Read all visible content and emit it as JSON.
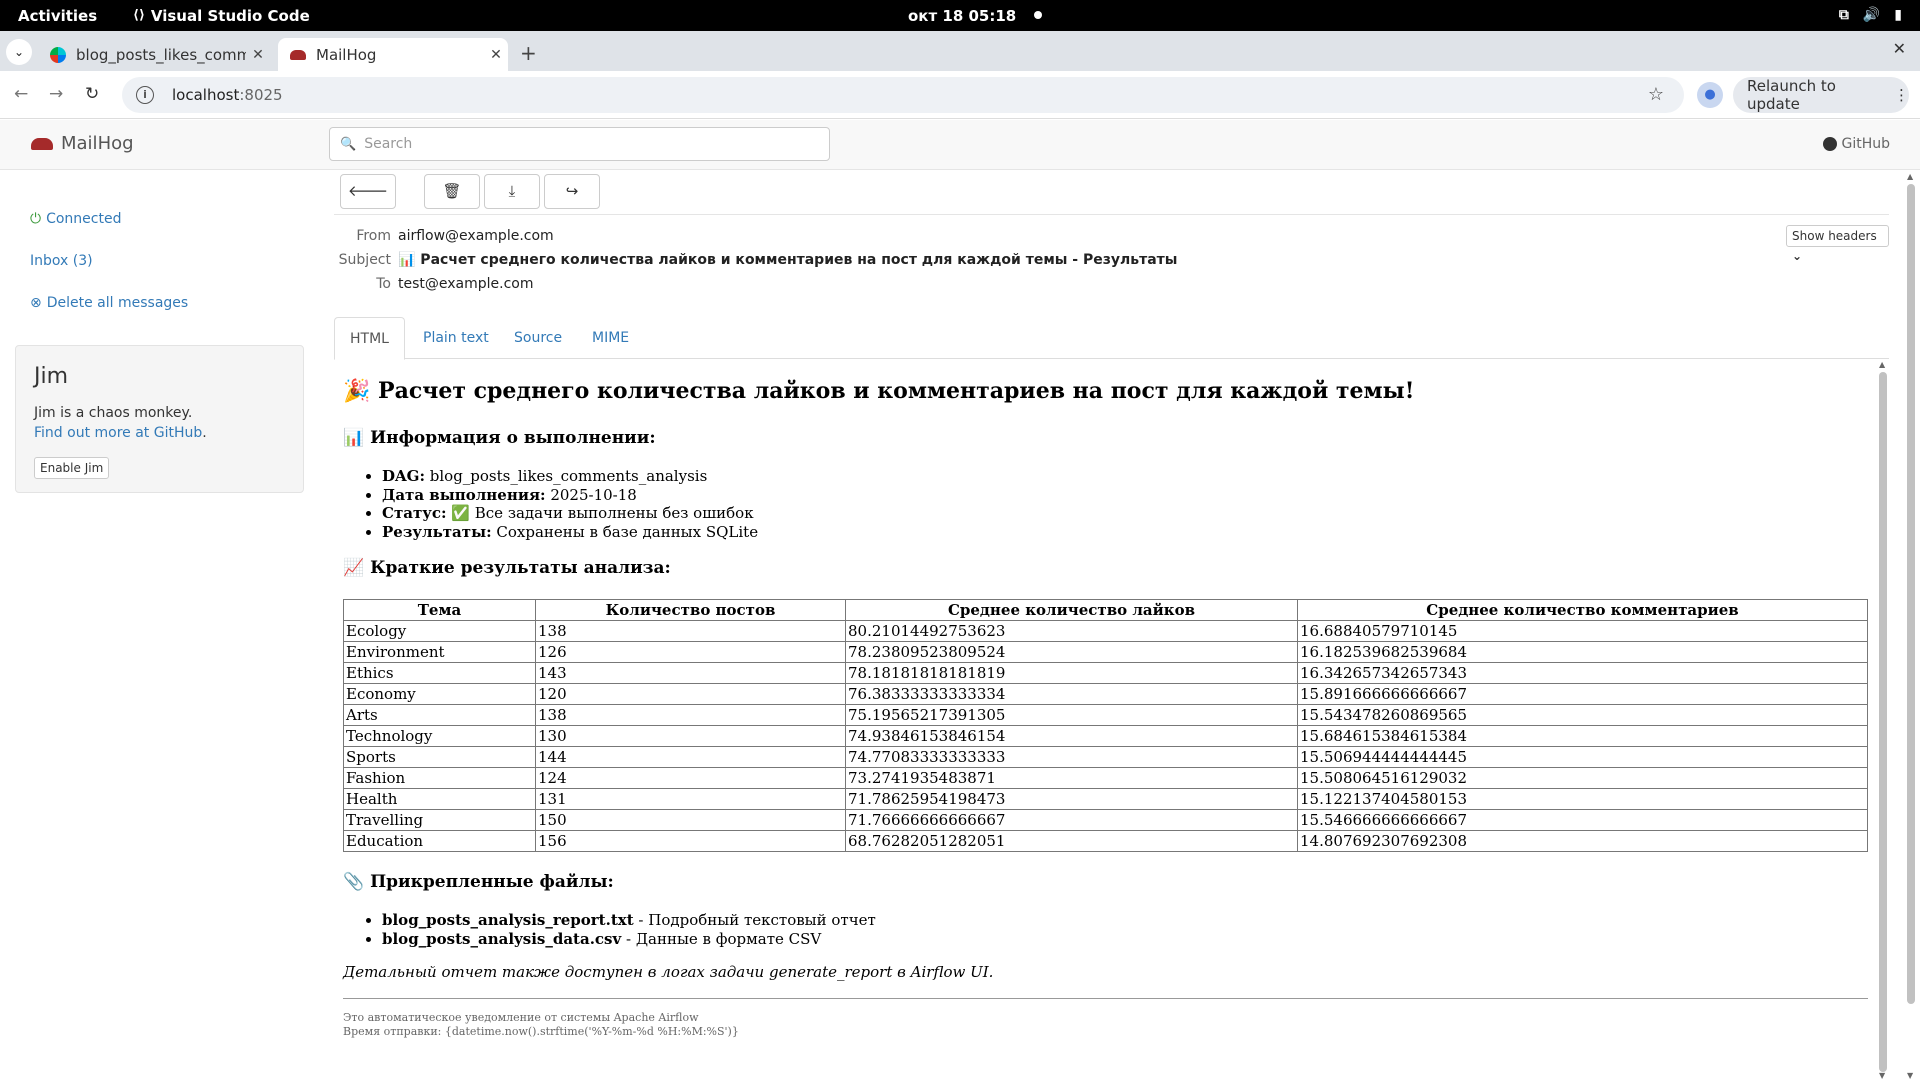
{
  "system": {
    "activities": "Activities",
    "app_name": "Visual Studio Code",
    "clock": "окт 18  05:18"
  },
  "browser": {
    "tabs": [
      {
        "title": "blog_posts_likes_comm"
      },
      {
        "title": "MailHog"
      }
    ],
    "url_host": "localhost",
    "url_port": ":8025",
    "relaunch_label": "Relaunch to update"
  },
  "mailhog": {
    "brand": "MailHog",
    "search_placeholder": "Search",
    "github": "GitHub",
    "sidebar": {
      "connected": "Connected",
      "inbox": "Inbox (3)",
      "delete_all": "Delete all messages"
    },
    "jim": {
      "title": "Jim",
      "desc": "Jim is a chaos monkey.",
      "link": "Find out more at GitHub",
      "link_suffix": ".",
      "button": "Enable Jim"
    },
    "message": {
      "from_label": "From",
      "from": "airflow@example.com",
      "subject_label": "Subject",
      "subject": "📊 Расчет среднего количества лайков и комментариев на пост для каждой темы - Результаты",
      "to_label": "To",
      "to": "test@example.com",
      "show_headers": "Show headers"
    },
    "tabs": [
      "HTML",
      "Plain text",
      "Source",
      "MIME"
    ]
  },
  "email": {
    "title": "🎉 Расчет среднего количества лайков и комментариев на пост для каждой темы!",
    "info_heading": "📊 Информация о выполнении:",
    "info": [
      {
        "key": "DAG:",
        "value": " blog_posts_likes_comments_analysis"
      },
      {
        "key": "Дата выполнения:",
        "value": " 2025-10-18"
      },
      {
        "key": "Статус:",
        "value": " ✅ Все задачи выполнены без ошибок"
      },
      {
        "key": "Результаты:",
        "value": " Сохранены в базе данных SQLite"
      }
    ],
    "results_heading": "📈 Краткие результаты анализа:",
    "table": {
      "headers": [
        "Тема",
        "Количество постов",
        "Среднее количество лайков",
        "Среднее количество комментариев"
      ],
      "rows": [
        [
          "Ecology",
          "138",
          "80.21014492753623",
          "16.68840579710145"
        ],
        [
          "Environment",
          "126",
          "78.23809523809524",
          "16.182539682539684"
        ],
        [
          "Ethics",
          "143",
          "78.18181818181819",
          "16.342657342657343"
        ],
        [
          "Economy",
          "120",
          "76.38333333333334",
          "15.891666666666667"
        ],
        [
          "Arts",
          "138",
          "75.19565217391305",
          "15.543478260869565"
        ],
        [
          "Technology",
          "130",
          "74.93846153846154",
          "15.684615384615384"
        ],
        [
          "Sports",
          "144",
          "74.77083333333333",
          "15.506944444444445"
        ],
        [
          "Fashion",
          "124",
          "73.2741935483871",
          "15.508064516129032"
        ],
        [
          "Health",
          "131",
          "71.78625954198473",
          "15.122137404580153"
        ],
        [
          "Travelling",
          "150",
          "71.76666666666667",
          "15.546666666666667"
        ],
        [
          "Education",
          "156",
          "68.76282051282051",
          "14.807692307692308"
        ]
      ]
    },
    "attachments_heading": "📎 Прикрепленные файлы:",
    "attachments": [
      {
        "name": "blog_posts_analysis_report.txt",
        "desc": " - Подробный текстовый отчет"
      },
      {
        "name": "blog_posts_analysis_data.csv",
        "desc": " - Данные в формате CSV"
      }
    ],
    "note": "Детальный отчет также доступен в логах задачи generate_report в Airflow UI.",
    "footer_line1": "Это автоматическое уведомление от системы Apache Airflow",
    "footer_line2": "Время отправки: {datetime.now().strftime('%Y-%m-%d %H:%M:%S')}"
  }
}
